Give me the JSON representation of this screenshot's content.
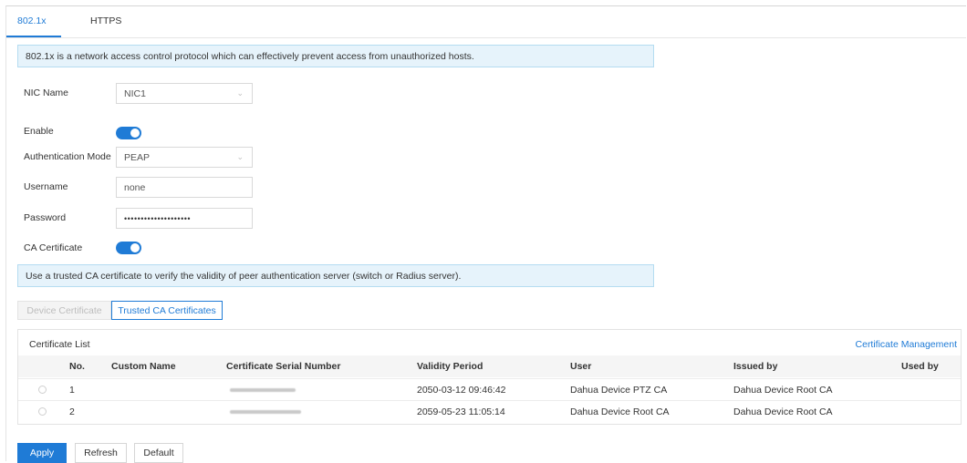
{
  "tabs": [
    {
      "label": "802.1x",
      "active": true
    },
    {
      "label": "HTTPS",
      "active": false
    }
  ],
  "info_8021x": "802.1x is a network access control protocol which can effectively prevent access from unauthorized hosts.",
  "form": {
    "nic_label": "NIC Name",
    "nic_value": "NIC1",
    "enable_label": "Enable",
    "enable_on": true,
    "auth_label": "Authentication Mode",
    "auth_value": "PEAP",
    "username_label": "Username",
    "username_value": "none",
    "password_label": "Password",
    "password_value": "••••••••••••••••••••",
    "ca_label": "CA Certificate",
    "ca_on": true
  },
  "info_ca": "Use a trusted CA certificate to verify the validity of peer authentication server (switch or Radius server).",
  "cert_tabs": {
    "device": "Device Certificate",
    "trusted": "Trusted CA Certificates"
  },
  "cert_list": {
    "title": "Certificate List",
    "manage": "Certificate Management",
    "columns": [
      "No.",
      "Custom Name",
      "Certificate Serial Number",
      "Validity Period",
      "User",
      "Issued by",
      "Used by"
    ],
    "rows": [
      {
        "no": "1",
        "custom_name": "",
        "validity": "2050-03-12 09:46:42",
        "user": "Dahua Device PTZ CA",
        "issued_by": "Dahua Device Root CA",
        "used_by": ""
      },
      {
        "no": "2",
        "custom_name": "",
        "validity": "2059-05-23 11:05:14",
        "user": "Dahua Device Root CA",
        "issued_by": "Dahua Device Root CA",
        "used_by": ""
      }
    ]
  },
  "actions": {
    "apply": "Apply",
    "refresh": "Refresh",
    "default": "Default"
  },
  "colors": {
    "accent": "#1f7bd6",
    "info_bg": "#e6f3fb",
    "info_border": "#b4dcf1"
  }
}
